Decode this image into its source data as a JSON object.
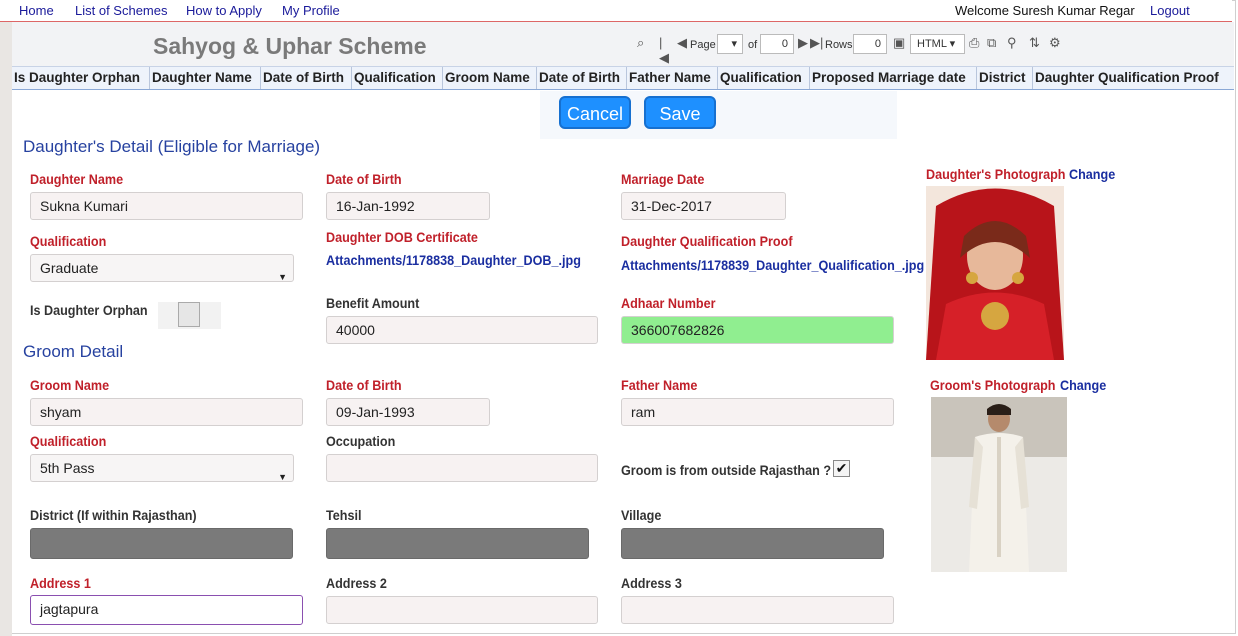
{
  "nav": {
    "home": "Home",
    "schemes": "List of Schemes",
    "apply": "How to Apply",
    "profile": "My Profile",
    "welcome": "Welcome Suresh Kumar Regar",
    "logout": "Logout"
  },
  "page": {
    "title": "Sahyog & Uphar Scheme"
  },
  "pager": {
    "page_label": "Page",
    "of_label": "of",
    "total_pages": "0",
    "rows_label": "Rows",
    "rows_value": "0",
    "format": "HTML"
  },
  "grid": {
    "columns": [
      "Is Daughter Orphan",
      "Daughter Name",
      "Date of Birth",
      "Qualification",
      "Groom Name",
      "Date of Birth",
      "Father Name",
      "Qualification",
      "Proposed Marriage date",
      "District",
      "Daughter Qualification Proof"
    ]
  },
  "actions": {
    "cancel": "Cancel",
    "save": "Save"
  },
  "daughter": {
    "section": "Daughter's Detail (Eligible for Marriage)",
    "name_label": "Daughter Name",
    "name": "Sukna Kumari",
    "dob_label": "Date of Birth",
    "dob": "16-Jan-1992",
    "marriage_label": "Marriage Date",
    "marriage": "31-Dec-2017",
    "photo_label": "Daughter's Photograph",
    "change": "Change",
    "qual_label": "Qualification",
    "qual": "Graduate",
    "dob_cert_label": "Daughter DOB Certificate",
    "dob_cert_link": "Attachments/1178838_Daughter_DOB_.jpg",
    "qual_proof_label": "Daughter Qualification Proof",
    "qual_proof_link": "Attachments/1178839_Daughter_Qualification_.jpg",
    "orphan_label": "Is Daughter Orphan",
    "benefit_label": "Benefit Amount",
    "benefit": "40000",
    "aadhaar_label": "Adhaar Number",
    "aadhaar": "366007682826"
  },
  "groom": {
    "section": "Groom Detail",
    "name_label": "Groom Name",
    "name": "shyam",
    "dob_label": "Date of Birth",
    "dob": "09-Jan-1993",
    "father_label": "Father Name",
    "father": "ram",
    "photo_label": "Groom's Photograph",
    "change": "Change",
    "qual_label": "Qualification",
    "qual": "5th Pass",
    "occupation_label": "Occupation",
    "occupation": "",
    "outside_label": "Groom is from outside Rajasthan ?",
    "district_label": "District (If within Rajasthan)",
    "tehsil_label": "Tehsil",
    "village_label": "Village",
    "addr1_label": "Address 1",
    "addr1": "jagtapura",
    "addr2_label": "Address 2",
    "addr2": "",
    "addr3_label": "Address 3",
    "addr3": ""
  },
  "icons": {
    "first": "first-page-icon",
    "prev": "prev-page-icon",
    "next": "next-page-icon",
    "last": "last-page-icon",
    "save_disk": "floppy-disk-icon",
    "print": "print-icon",
    "export": "export-icon",
    "find": "find-icon",
    "sort": "sort-icon",
    "settings": "settings-icon",
    "check": "checkmark-icon"
  },
  "colors": {
    "required_label": "#c0202a",
    "section": "#2742a0",
    "button": "#1e90ff",
    "aadhaar_valid": "#90ee90",
    "disabled": "#7a7a7a"
  }
}
